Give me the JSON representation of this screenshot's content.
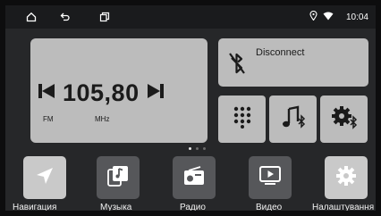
{
  "status_bar": {
    "time": "10:04",
    "icons": [
      "home-icon",
      "back-icon",
      "recent-apps-icon",
      "location-icon",
      "wifi-icon"
    ]
  },
  "radio": {
    "frequency": "105,80",
    "band": "FM",
    "unit": "MHz"
  },
  "bluetooth": {
    "status": "Disconnect"
  },
  "shortcuts": [
    "dialpad-icon",
    "bluetooth-music-icon",
    "bluetooth-settings-icon"
  ],
  "pager": {
    "pages": 3,
    "active": 1
  },
  "dock": [
    {
      "label": "Навигация",
      "icon": "navigation-icon"
    },
    {
      "label": "Музыка",
      "icon": "music-icon"
    },
    {
      "label": "Радио",
      "icon": "radio-icon"
    },
    {
      "label": "Видео",
      "icon": "video-icon"
    },
    {
      "label": "Налаштування",
      "icon": "settings-icon"
    }
  ]
}
